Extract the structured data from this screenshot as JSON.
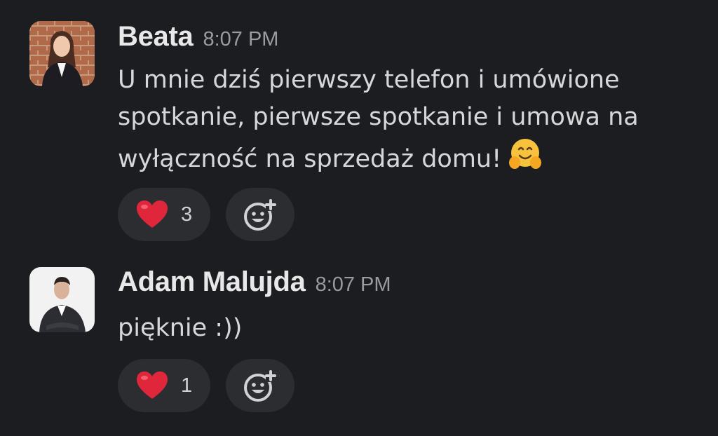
{
  "messages": [
    {
      "author": "Beata",
      "time": "8:07 PM",
      "lines": [
        "U mnie dziś pierwszy telefon i umówione",
        "spotkanie, pierwsze spotkanie i umowa na",
        "wyłączność na sprzedaż domu!"
      ],
      "trailing_emoji": "hugging-face",
      "reactions": [
        {
          "emoji": "red-heart",
          "count": "3"
        }
      ],
      "add_reaction_icon": "add-reaction-icon"
    },
    {
      "author": "Adam Malujda",
      "time": "8:07 PM",
      "lines": [
        "pięknie :))"
      ],
      "reactions": [
        {
          "emoji": "red-heart",
          "count": "1"
        }
      ],
      "add_reaction_icon": "add-reaction-icon"
    }
  ],
  "colors": {
    "background": "#1b1d21",
    "pill": "#2c2d31",
    "author": "#e8e8e8",
    "timestamp": "#9a9b9e",
    "heart": "#e0263b"
  }
}
